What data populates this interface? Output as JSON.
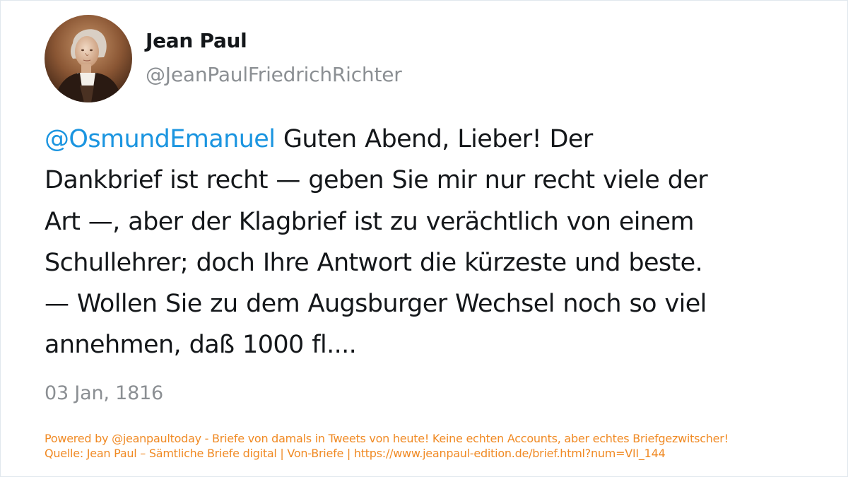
{
  "author": {
    "display_name": "Jean Paul",
    "handle": "@JeanPaulFriedrichRichter",
    "avatar_icon": "portrait-avatar-icon"
  },
  "tweet": {
    "mention": "@OsmundEmanuel",
    "lines": [
      " Guten Abend, Lieber! Der",
      "Dankbrief ist recht — geben Sie mir nur recht viele der",
      "Art —, aber der Klagbrief ist zu verächtlich von einem",
      "Schullehrer; doch Ihre Antwort die kürzeste und beste.",
      "— Wollen Sie zu dem Augsburger Wechsel noch so viel",
      "annehmen, daß 1000 fl...."
    ],
    "date": "03 Jan, 1816"
  },
  "footer": {
    "powered_by": "Powered by @jeanpaultoday - Briefe von damals in Tweets von heute! Keine echten Accounts, aber echtes Briefgezwitscher!",
    "source": "Quelle: Jean Paul – Sämtliche Briefe digital | Von-Briefe | https://www.jeanpaul-edition.de/brief.html?num=VII_144"
  },
  "colors": {
    "text": "#14171a",
    "muted": "#8b8f93",
    "mention": "#1b95e0",
    "footer": "#f08a24"
  }
}
